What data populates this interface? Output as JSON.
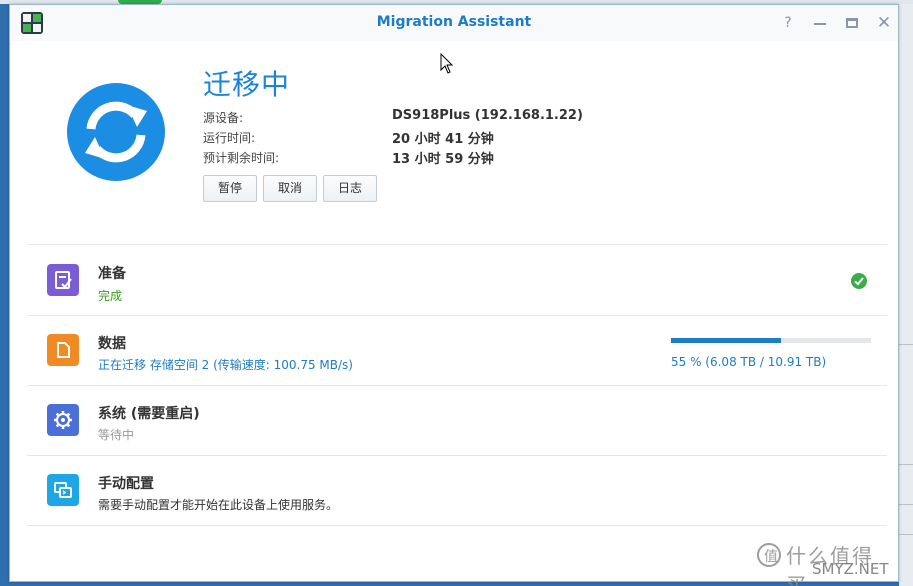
{
  "window": {
    "title": "Migration Assistant",
    "help_symbol": "?",
    "close_symbol": "✕"
  },
  "header": {
    "status": "迁移中",
    "info": [
      {
        "label": "源设备:",
        "value": "DS918Plus (192.168.1.22)"
      },
      {
        "label": "运行时间:",
        "value": "20 小时 41 分钟"
      },
      {
        "label": "预计剩余时间:",
        "value": "13 小时 59 分钟"
      }
    ],
    "buttons": {
      "pause": "暂停",
      "cancel": "取消",
      "log": "日志"
    }
  },
  "steps": [
    {
      "title": "准备",
      "status": "完成",
      "icon": "checklist-icon",
      "color": "#7b5cd6",
      "state": "done"
    },
    {
      "title": "数据",
      "status": "正在迁移 存储空间 2 (传输速度: 100.75 MB/s)",
      "icon": "document-icon",
      "color": "#f08a24",
      "state": "active",
      "progress": {
        "percent": 55,
        "text": "55 % (6.08 TB / 10.91 TB)"
      }
    },
    {
      "title": "系统 (需要重启)",
      "status": "等待中",
      "icon": "gear-icon",
      "color": "#4a6fd8",
      "state": "waiting"
    },
    {
      "title": "手动配置",
      "status": "需要手动配置才能开始在此设备上使用服务。",
      "icon": "manual-config-icon",
      "color": "#1fa6e6",
      "state": "note"
    }
  ],
  "colors": {
    "accent": "#1e7cc4",
    "sync_icon": "#1b8de2",
    "done": "#3aad46"
  },
  "watermark": {
    "cn": "什么值得买",
    "en": "SMYZ.NET"
  }
}
